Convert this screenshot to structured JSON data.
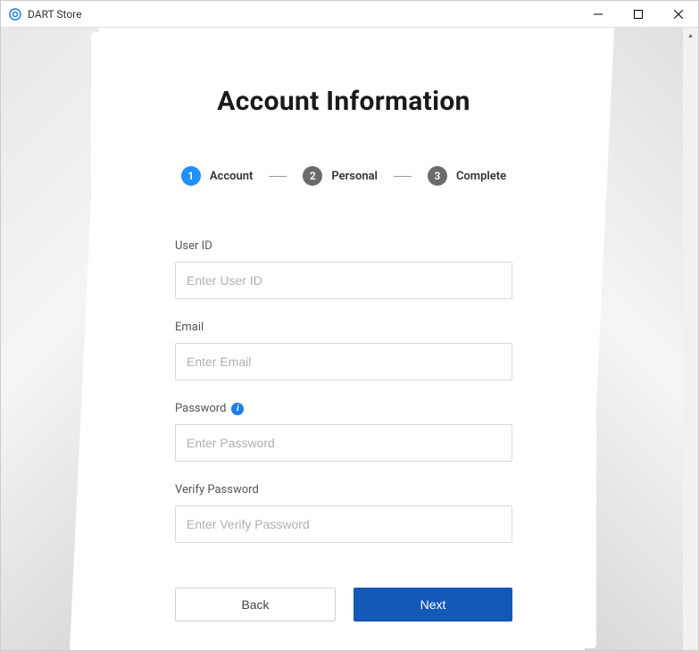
{
  "window": {
    "title": "DART Store"
  },
  "header": {
    "title": "Account Information"
  },
  "stepper": {
    "steps": [
      {
        "num": "1",
        "label": "Account",
        "active": true
      },
      {
        "num": "2",
        "label": "Personal",
        "active": false
      },
      {
        "num": "3",
        "label": "Complete",
        "active": false
      }
    ]
  },
  "form": {
    "user_id": {
      "label": "User ID",
      "placeholder": "Enter User ID",
      "value": ""
    },
    "email": {
      "label": "Email",
      "placeholder": "Enter Email",
      "value": ""
    },
    "password": {
      "label": "Password",
      "placeholder": "Enter Password",
      "value": "",
      "has_info": true
    },
    "verify_password": {
      "label": "Verify Password",
      "placeholder": "Enter Verify Password",
      "value": ""
    }
  },
  "buttons": {
    "back": "Back",
    "next": "Next"
  },
  "colors": {
    "primary_blue": "#1458b8",
    "step_active": "#1e90ff",
    "step_inactive": "#6b6b6b"
  }
}
